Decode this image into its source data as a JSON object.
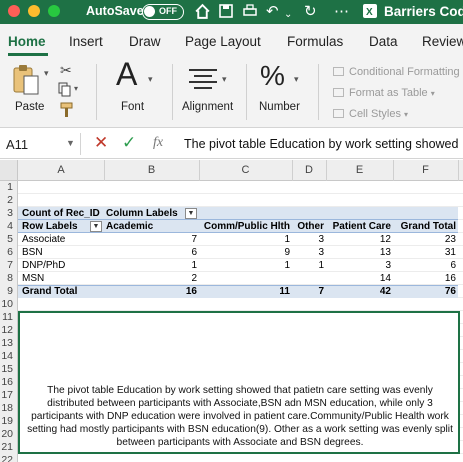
{
  "titlebar": {
    "autosave_label": "AutoSave",
    "autosave_state": "OFF",
    "document_title": "Barriers Code"
  },
  "tabs": [
    "Home",
    "Insert",
    "Draw",
    "Page Layout",
    "Formulas",
    "Data",
    "Review"
  ],
  "ribbon": {
    "paste": "Paste",
    "font": "Font",
    "alignment": "Alignment",
    "number": "Number",
    "percent_symbol": "%",
    "font_symbol": "A",
    "conditional_formatting": "Conditional Formatting",
    "format_as_table": "Format as Table",
    "cell_styles": "Cell Styles"
  },
  "formula_bar": {
    "name_box": "A11",
    "formula": "The pivot table Education by work setting showed"
  },
  "columns": [
    "A",
    "B",
    "C",
    "D",
    "E",
    "F"
  ],
  "rows": [
    "1",
    "2",
    "3",
    "4",
    "5",
    "6",
    "7",
    "8",
    "9",
    "10",
    "11",
    "12",
    "13",
    "14",
    "15",
    "16",
    "17",
    "18",
    "19",
    "20",
    "21",
    "22"
  ],
  "pivot": {
    "count_label": "Count of Rec_ID",
    "column_labels": "Column Labels",
    "row_labels": "Row Labels",
    "headers": [
      "Academic",
      "Comm/Public Hlth",
      "Other",
      "Patient Care",
      "Grand Total"
    ],
    "data_rows": [
      {
        "label": "Associate",
        "values": [
          "7",
          "1",
          "3",
          "12",
          "23"
        ]
      },
      {
        "label": "BSN",
        "values": [
          "6",
          "9",
          "3",
          "13",
          "31"
        ]
      },
      {
        "label": "DNP/PhD",
        "values": [
          "1",
          "1",
          "1",
          "3",
          "6"
        ]
      },
      {
        "label": "MSN",
        "values": [
          "2",
          "",
          "",
          "14",
          "16"
        ]
      }
    ],
    "grand_total": {
      "label": "Grand Total",
      "values": [
        "16",
        "11",
        "7",
        "42",
        "76"
      ]
    }
  },
  "textbox": {
    "text": "The pivot table Education by work setting showed that patietn care setting was evenly distributed between participants with Associate,BSN adn MSN education, while only 3 participants with DNP education were involved in patient care.Community/Public Health work setting had mostly participants with BSN education(9). Other as a work setting was evenly split between participants with Associate and BSN degrees."
  }
}
